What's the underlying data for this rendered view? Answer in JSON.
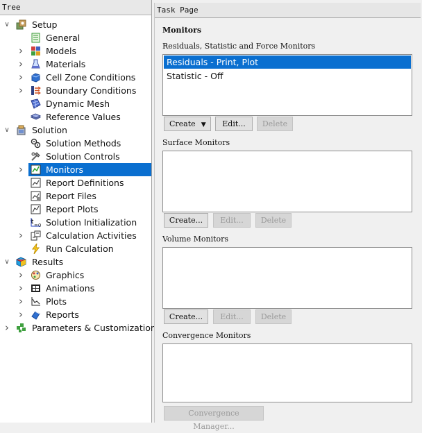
{
  "tree": {
    "header": "Tree",
    "items": [
      {
        "id": "setup",
        "label": "Setup",
        "level": 0,
        "arrow": "down",
        "icon": "setup-icon"
      },
      {
        "id": "general",
        "label": "General",
        "level": 1,
        "arrow": "",
        "icon": "general-icon"
      },
      {
        "id": "models",
        "label": "Models",
        "level": 1,
        "arrow": "right",
        "icon": "models-icon"
      },
      {
        "id": "materials",
        "label": "Materials",
        "level": 1,
        "arrow": "right",
        "icon": "materials-icon"
      },
      {
        "id": "cell-zone-conditions",
        "label": "Cell Zone Conditions",
        "level": 1,
        "arrow": "right",
        "icon": "cell-zone-icon"
      },
      {
        "id": "boundary-conditions",
        "label": "Boundary Conditions",
        "level": 1,
        "arrow": "right",
        "icon": "boundary-icon"
      },
      {
        "id": "dynamic-mesh",
        "label": "Dynamic Mesh",
        "level": 1,
        "arrow": "",
        "icon": "dynamic-mesh-icon"
      },
      {
        "id": "reference-values",
        "label": "Reference Values",
        "level": 1,
        "arrow": "",
        "icon": "reference-values-icon"
      },
      {
        "id": "solution",
        "label": "Solution",
        "level": 0,
        "arrow": "down",
        "icon": "solution-icon"
      },
      {
        "id": "solution-methods",
        "label": "Solution Methods",
        "level": 1,
        "arrow": "",
        "icon": "solution-methods-icon"
      },
      {
        "id": "solution-controls",
        "label": "Solution Controls",
        "level": 1,
        "arrow": "",
        "icon": "solution-controls-icon"
      },
      {
        "id": "monitors",
        "label": "Monitors",
        "level": 1,
        "arrow": "right",
        "icon": "monitors-icon",
        "selected": true
      },
      {
        "id": "report-definitions",
        "label": "Report Definitions",
        "level": 1,
        "arrow": "",
        "icon": "report-definitions-icon"
      },
      {
        "id": "report-files",
        "label": "Report Files",
        "level": 1,
        "arrow": "",
        "icon": "report-files-icon"
      },
      {
        "id": "report-plots",
        "label": "Report Plots",
        "level": 1,
        "arrow": "",
        "icon": "report-plots-icon"
      },
      {
        "id": "solution-initialization",
        "label": "Solution Initialization",
        "level": 1,
        "arrow": "",
        "icon": "initialization-icon"
      },
      {
        "id": "calculation-activities",
        "label": "Calculation Activities",
        "level": 1,
        "arrow": "right",
        "icon": "calculation-activities-icon"
      },
      {
        "id": "run-calculation",
        "label": "Run Calculation",
        "level": 1,
        "arrow": "",
        "icon": "run-calculation-icon"
      },
      {
        "id": "results",
        "label": "Results",
        "level": 0,
        "arrow": "down",
        "icon": "results-icon"
      },
      {
        "id": "graphics",
        "label": "Graphics",
        "level": 1,
        "arrow": "right",
        "icon": "graphics-icon"
      },
      {
        "id": "animations",
        "label": "Animations",
        "level": 1,
        "arrow": "right",
        "icon": "animations-icon"
      },
      {
        "id": "plots",
        "label": "Plots",
        "level": 1,
        "arrow": "right",
        "icon": "plots-icon"
      },
      {
        "id": "reports",
        "label": "Reports",
        "level": 1,
        "arrow": "right",
        "icon": "reports-icon"
      },
      {
        "id": "parameters",
        "label": "Parameters & Customization",
        "level": 0,
        "arrow": "right",
        "icon": "parameters-icon"
      }
    ]
  },
  "task_page": {
    "header": "Task Page",
    "title": "Monitors",
    "residuals": {
      "label": "Residuals, Statistic and Force Monitors",
      "items": [
        "Residuals - Print, Plot",
        "Statistic - Off"
      ],
      "selected_index": 0,
      "create_label": "Create",
      "edit_label": "Edit...",
      "delete_label": "Delete"
    },
    "surface": {
      "label": "Surface Monitors",
      "create_label": "Create...",
      "edit_label": "Edit...",
      "delete_label": "Delete"
    },
    "volume": {
      "label": "Volume Monitors",
      "create_label": "Create...",
      "edit_label": "Edit...",
      "delete_label": "Delete"
    },
    "convergence": {
      "label": "Convergence Monitors",
      "manager_label": "Convergence Manager..."
    }
  }
}
